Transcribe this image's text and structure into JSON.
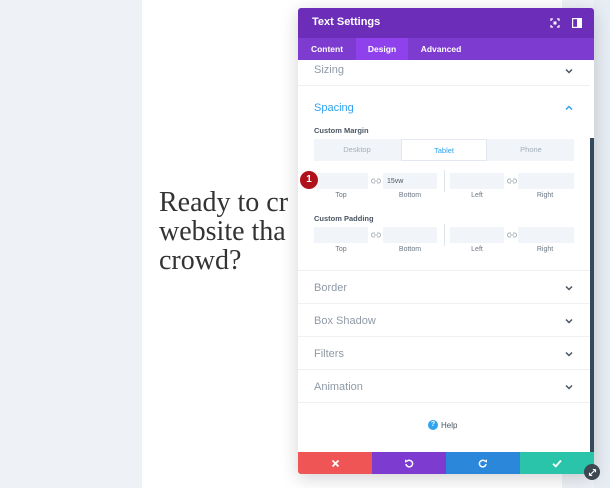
{
  "page": {
    "headline": "Ready to cr\nwebsite tha\ncrowd?"
  },
  "modal": {
    "title": "Text Settings",
    "tabs": [
      "Content",
      "Design",
      "Advanced"
    ],
    "active_tab": "Design",
    "sections": {
      "sizing": "Sizing",
      "spacing": "Spacing",
      "border": "Border",
      "box_shadow": "Box Shadow",
      "filters": "Filters",
      "animation": "Animation"
    },
    "spacing": {
      "margin_label": "Custom Margin",
      "padding_label": "Custom Padding",
      "device_tabs": [
        "Desktop",
        "Tablet",
        "Phone"
      ],
      "active_device": "Tablet",
      "margin": {
        "top": "",
        "bottom": "15vw",
        "left": "",
        "right": ""
      },
      "padding": {
        "top": "",
        "bottom": "",
        "left": "",
        "right": ""
      },
      "input_labels": [
        "Top",
        "Bottom",
        "Left",
        "Right"
      ]
    },
    "badge_number": "1",
    "help_label": "Help",
    "footer_buttons": [
      "cancel",
      "undo",
      "redo",
      "save"
    ]
  },
  "colors": {
    "header_purple": "#6c2eb9",
    "tabs_purple": "#7e3bd0",
    "accent_blue": "#2ea3f2",
    "cancel_red": "#ef5555",
    "redo_blue": "#2b87da",
    "save_green": "#29c4a9",
    "badge_red": "#b0121b"
  }
}
